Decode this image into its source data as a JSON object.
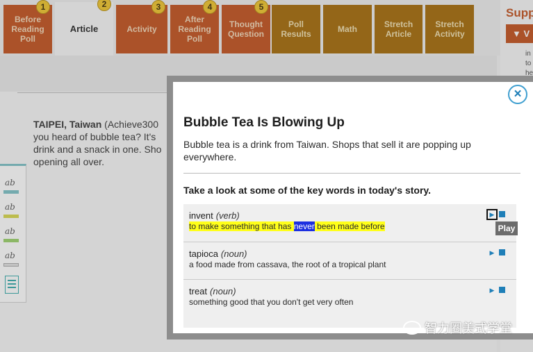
{
  "tabs": [
    {
      "label": "Before Reading Poll",
      "number": "1"
    },
    {
      "label": "Article",
      "number": "2",
      "active": true
    },
    {
      "label": "Activity",
      "number": "3"
    },
    {
      "label": "After Reading Poll",
      "number": "4"
    },
    {
      "label": "Thought Question",
      "number": "5"
    },
    {
      "label": "Poll Results"
    },
    {
      "label": "Math"
    },
    {
      "label": "Stretch Article"
    },
    {
      "label": "Stretch Activity"
    }
  ],
  "support": {
    "title": "Supp",
    "button_label": "▼ V",
    "snippets": [
      "in",
      "to",
      "he"
    ]
  },
  "article": {
    "location": "TAIPEI, Taiwan",
    "line1_rest": " (Achieve300",
    "line2": "you heard of bubble tea? It's",
    "line3": "drink and a snack in one. Sho",
    "line4": "opening all over."
  },
  "modal": {
    "close_label": "×",
    "title": "Bubble Tea Is Blowing Up",
    "description": "Bubble tea is a drink from Taiwan. Shops that sell it are popping up everywhere.",
    "words_heading": "Take a look at some of the key words in today's story.",
    "play_tooltip": "Play",
    "play_glyph": "▶",
    "words": [
      {
        "word": "invent",
        "pos": "(verb)",
        "def_before": "to make something that has ",
        "def_highlight": "never",
        "def_after": " been made before"
      },
      {
        "word": "tapioca",
        "pos": "(noun)",
        "definition": "a food made from cassava, the root of a tropical plant"
      },
      {
        "word": "treat",
        "pos": "(noun)",
        "definition": "something good that you don't get very often"
      }
    ]
  },
  "toolbar": {
    "tool_label": "ab",
    "highlight_colors": [
      "#7cc0c6",
      "#d8d84a",
      "#9ad16a",
      "#e0e0e0"
    ]
  },
  "watermark": "智力圈美式学堂"
}
